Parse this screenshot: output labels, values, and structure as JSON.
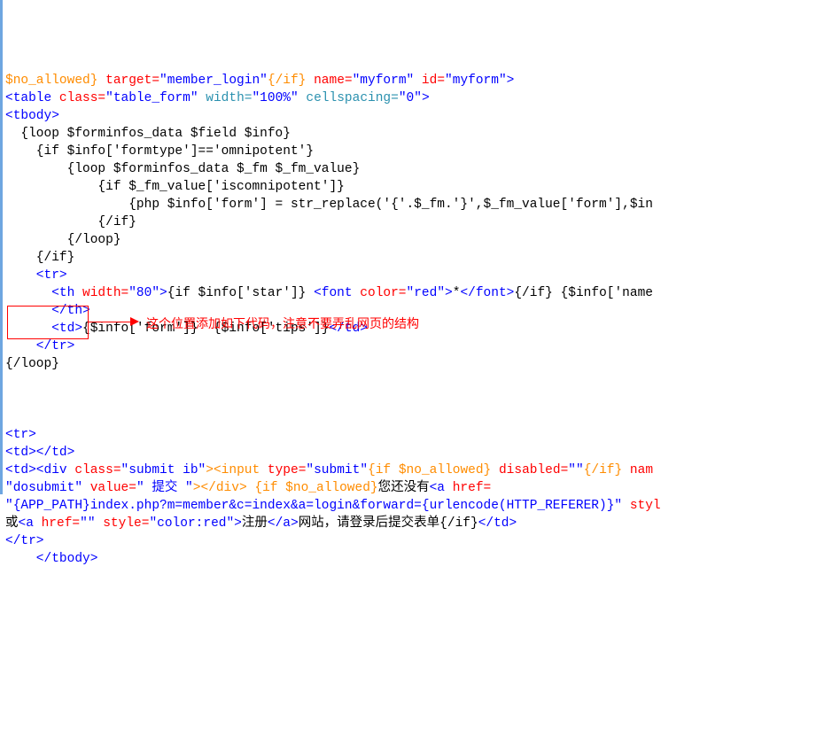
{
  "annotation": {
    "note": "这个位置添加如下代码，注意不要弄乱网页的结构"
  },
  "code": {
    "l01a": "$no_allowed}",
    "l01b": " target=",
    "l01c": "\"member_login\"",
    "l01d": "{/if}",
    "l01e": " name=",
    "l01f": "\"myform\"",
    "l01g": " id=",
    "l01h": "\"myform\"",
    "l01i": ">",
    "l02a": "<table ",
    "l02b": "class=",
    "l02c": "\"table_form\"",
    "l02d": " width=",
    "l02e": "\"100%\"",
    "l02f": " cellspacing=",
    "l02g": "\"0\"",
    "l02h": ">",
    "l03": "<tbody>",
    "l04": "  {loop $forminfos_data $field $info}",
    "l05": "    {if $info['formtype']=='omnipotent'}",
    "l06": "        {loop $forminfos_data $_fm $_fm_value}",
    "l07": "            {if $_fm_value['iscomnipotent']}",
    "l08": "                {php $info['form'] = str_replace('{'.$_fm.'}',$_fm_value['form'],$in",
    "l09": "            {/if}",
    "l10": "        {/loop}",
    "l11": "    {/if}",
    "l12": "    <tr>",
    "l13a": "      <th ",
    "l13b": "width=",
    "l13c": "\"80\"",
    "l13d": ">",
    "l13e": "{if $info['star']} ",
    "l13f": "<font ",
    "l13g": "color=",
    "l13h": "\"red\"",
    "l13i": ">",
    "l13j": "*",
    "l13k": "</font>",
    "l13l": "{/if} {$info['name",
    "l14": "      </th>",
    "l15a": "      <td>",
    "l15b": "{$info['form']}  {$info['tips']}",
    "l15c": "</td>",
    "l16": "    </tr>",
    "l17": "{/loop}",
    "l20": "<tr>",
    "l21": "<td></td>",
    "l22a": "<td><div ",
    "l22b": "class=",
    "l22c": "\"submit ib\"",
    "l22d": "><input ",
    "l22e": "type=",
    "l22f": "\"submit\"",
    "l22g": "{if $no_allowed} ",
    "l22h": "disabled=",
    "l22i": "\"\"",
    "l22j": "{/if}",
    "l22k": " nam",
    "l23a": "\"dosubmit\"",
    "l23b": " value=",
    "l23c": "\" 提交 \"",
    "l23d": "></div> ",
    "l23e": "{if $no_allowed}",
    "l23f": "您还没有",
    "l23g": "<a ",
    "l23h": "href=",
    "l24a": "\"{APP_PATH}index.php?m=member&c=index&a=login&forward={urlencode(HTTP_REFERER)}\"",
    "l24b": " styl",
    "l25a": "或",
    "l25b": "<a ",
    "l25c": "href=",
    "l25d": "\"\"",
    "l25e": " style=",
    "l25f": "\"color:red\"",
    "l25g": ">",
    "l25h": "注册",
    "l25i": "</a>",
    "l25j": "网站，请登录后提交表单{/if}",
    "l25k": "</td>",
    "l26": "</tr>",
    "l27": "    </tbody>"
  }
}
